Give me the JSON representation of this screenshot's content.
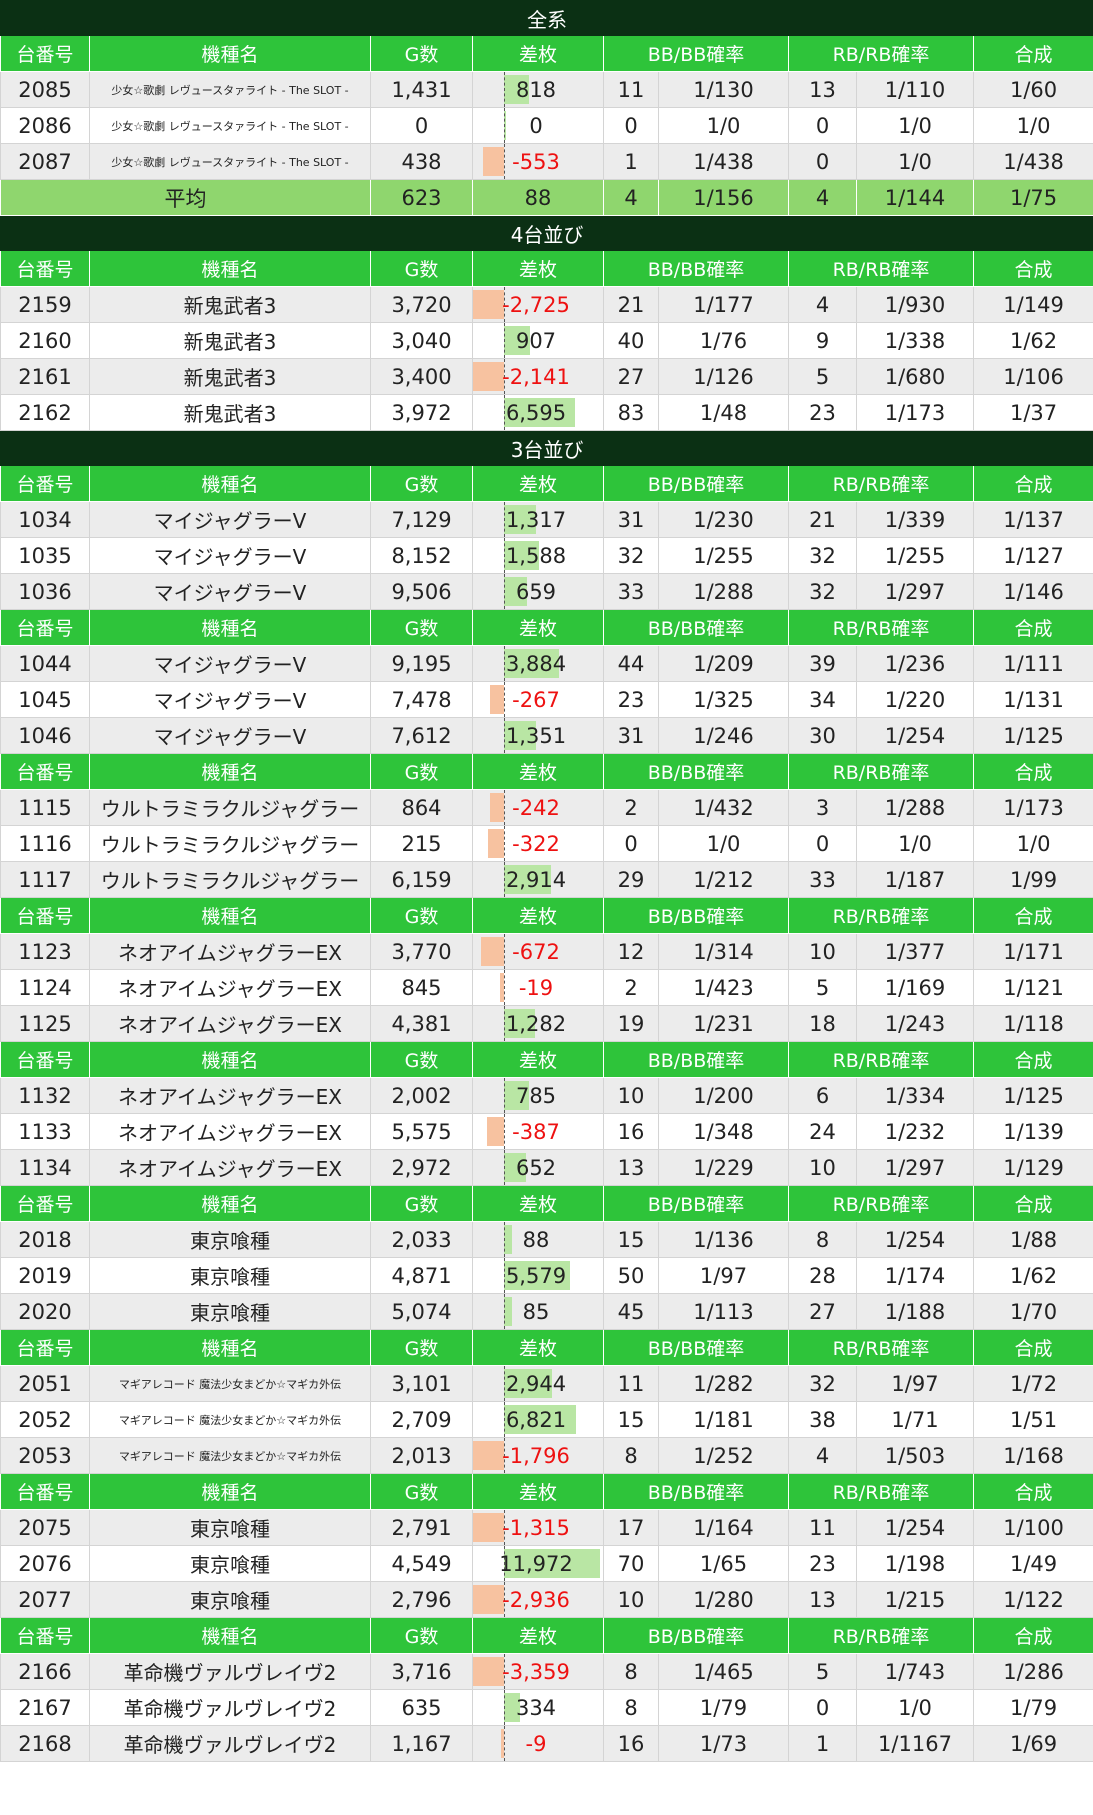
{
  "columns": [
    "台番号",
    "機種名",
    "G数",
    "差枚",
    "BB/BB確率",
    "RB/RB確率",
    "合成"
  ],
  "colors": {
    "section": "#0b3014",
    "header": "#2ec43a",
    "average": "#8fd66e",
    "positive_bar": "#b9e6a4",
    "negative_bar": "#f7c2a0",
    "negative_text": "#ee1111"
  },
  "sections": [
    {
      "title": "全系",
      "groups": [
        {
          "rows": [
            {
              "no": "2085",
              "name": "少女☆歌劇 レヴュースタァライト - The SLOT -",
              "g": "1,431",
              "diff": "818",
              "diff_value": 818,
              "bb": "11",
              "bbp": "1/130",
              "rb": "13",
              "rbp": "1/110",
              "total": "1/60"
            },
            {
              "no": "2086",
              "name": "少女☆歌劇 レヴュースタァライト - The SLOT -",
              "g": "0",
              "diff": "0",
              "diff_value": 0,
              "bb": "0",
              "bbp": "1/0",
              "rb": "0",
              "rbp": "1/0",
              "total": "1/0"
            },
            {
              "no": "2087",
              "name": "少女☆歌劇 レヴュースタァライト - The SLOT -",
              "g": "438",
              "diff": "-553",
              "diff_value": -553,
              "bb": "1",
              "bbp": "1/438",
              "rb": "0",
              "rbp": "1/0",
              "total": "1/438"
            }
          ]
        }
      ],
      "average": {
        "label": "平均",
        "g": "623",
        "diff": "88",
        "bb": "4",
        "bbp": "1/156",
        "rb": "4",
        "rbp": "1/144",
        "total": "1/75"
      }
    },
    {
      "title": "4台並び",
      "groups": [
        {
          "rows": [
            {
              "no": "2159",
              "name": "新鬼武者3",
              "g": "3,720",
              "diff": "-2,725",
              "diff_value": -2725,
              "bb": "21",
              "bbp": "1/177",
              "rb": "4",
              "rbp": "1/930",
              "total": "1/149"
            },
            {
              "no": "2160",
              "name": "新鬼武者3",
              "g": "3,040",
              "diff": "907",
              "diff_value": 907,
              "bb": "40",
              "bbp": "1/76",
              "rb": "9",
              "rbp": "1/338",
              "total": "1/62"
            },
            {
              "no": "2161",
              "name": "新鬼武者3",
              "g": "3,400",
              "diff": "-2,141",
              "diff_value": -2141,
              "bb": "27",
              "bbp": "1/126",
              "rb": "5",
              "rbp": "1/680",
              "total": "1/106"
            },
            {
              "no": "2162",
              "name": "新鬼武者3",
              "g": "3,972",
              "diff": "6,595",
              "diff_value": 6595,
              "bb": "83",
              "bbp": "1/48",
              "rb": "23",
              "rbp": "1/173",
              "total": "1/37"
            }
          ]
        }
      ]
    },
    {
      "title": "3台並び",
      "groups": [
        {
          "rows": [
            {
              "no": "1034",
              "name": "マイジャグラーV",
              "g": "7,129",
              "diff": "1,317",
              "diff_value": 1317,
              "bb": "31",
              "bbp": "1/230",
              "rb": "21",
              "rbp": "1/339",
              "total": "1/137"
            },
            {
              "no": "1035",
              "name": "マイジャグラーV",
              "g": "8,152",
              "diff": "1,588",
              "diff_value": 1588,
              "bb": "32",
              "bbp": "1/255",
              "rb": "32",
              "rbp": "1/255",
              "total": "1/127"
            },
            {
              "no": "1036",
              "name": "マイジャグラーV",
              "g": "9,506",
              "diff": "659",
              "diff_value": 659,
              "bb": "33",
              "bbp": "1/288",
              "rb": "32",
              "rbp": "1/297",
              "total": "1/146"
            }
          ]
        },
        {
          "rows": [
            {
              "no": "1044",
              "name": "マイジャグラーV",
              "g": "9,195",
              "diff": "3,884",
              "diff_value": 3884,
              "bb": "44",
              "bbp": "1/209",
              "rb": "39",
              "rbp": "1/236",
              "total": "1/111"
            },
            {
              "no": "1045",
              "name": "マイジャグラーV",
              "g": "7,478",
              "diff": "-267",
              "diff_value": -267,
              "bb": "23",
              "bbp": "1/325",
              "rb": "34",
              "rbp": "1/220",
              "total": "1/131"
            },
            {
              "no": "1046",
              "name": "マイジャグラーV",
              "g": "7,612",
              "diff": "1,351",
              "diff_value": 1351,
              "bb": "31",
              "bbp": "1/246",
              "rb": "30",
              "rbp": "1/254",
              "total": "1/125"
            }
          ]
        },
        {
          "rows": [
            {
              "no": "1115",
              "name": "ウルトラミラクルジャグラー",
              "g": "864",
              "diff": "-242",
              "diff_value": -242,
              "bb": "2",
              "bbp": "1/432",
              "rb": "3",
              "rbp": "1/288",
              "total": "1/173"
            },
            {
              "no": "1116",
              "name": "ウルトラミラクルジャグラー",
              "g": "215",
              "diff": "-322",
              "diff_value": -322,
              "bb": "0",
              "bbp": "1/0",
              "rb": "0",
              "rbp": "1/0",
              "total": "1/0"
            },
            {
              "no": "1117",
              "name": "ウルトラミラクルジャグラー",
              "g": "6,159",
              "diff": "2,914",
              "diff_value": 2914,
              "bb": "29",
              "bbp": "1/212",
              "rb": "33",
              "rbp": "1/187",
              "total": "1/99"
            }
          ]
        },
        {
          "rows": [
            {
              "no": "1123",
              "name": "ネオアイムジャグラーEX",
              "g": "3,770",
              "diff": "-672",
              "diff_value": -672,
              "bb": "12",
              "bbp": "1/314",
              "rb": "10",
              "rbp": "1/377",
              "total": "1/171"
            },
            {
              "no": "1124",
              "name": "ネオアイムジャグラーEX",
              "g": "845",
              "diff": "-19",
              "diff_value": -19,
              "bb": "2",
              "bbp": "1/423",
              "rb": "5",
              "rbp": "1/169",
              "total": "1/121"
            },
            {
              "no": "1125",
              "name": "ネオアイムジャグラーEX",
              "g": "4,381",
              "diff": "1,282",
              "diff_value": 1282,
              "bb": "19",
              "bbp": "1/231",
              "rb": "18",
              "rbp": "1/243",
              "total": "1/118"
            }
          ]
        },
        {
          "rows": [
            {
              "no": "1132",
              "name": "ネオアイムジャグラーEX",
              "g": "2,002",
              "diff": "785",
              "diff_value": 785,
              "bb": "10",
              "bbp": "1/200",
              "rb": "6",
              "rbp": "1/334",
              "total": "1/125"
            },
            {
              "no": "1133",
              "name": "ネオアイムジャグラーEX",
              "g": "5,575",
              "diff": "-387",
              "diff_value": -387,
              "bb": "16",
              "bbp": "1/348",
              "rb": "24",
              "rbp": "1/232",
              "total": "1/139"
            },
            {
              "no": "1134",
              "name": "ネオアイムジャグラーEX",
              "g": "2,972",
              "diff": "652",
              "diff_value": 652,
              "bb": "13",
              "bbp": "1/229",
              "rb": "10",
              "rbp": "1/297",
              "total": "1/129"
            }
          ]
        },
        {
          "rows": [
            {
              "no": "2018",
              "name": "東京喰種",
              "g": "2,033",
              "diff": "88",
              "diff_value": 88,
              "bb": "15",
              "bbp": "1/136",
              "rb": "8",
              "rbp": "1/254",
              "total": "1/88"
            },
            {
              "no": "2019",
              "name": "東京喰種",
              "g": "4,871",
              "diff": "5,579",
              "diff_value": 5579,
              "bb": "50",
              "bbp": "1/97",
              "rb": "28",
              "rbp": "1/174",
              "total": "1/62"
            },
            {
              "no": "2020",
              "name": "東京喰種",
              "g": "5,074",
              "diff": "85",
              "diff_value": 85,
              "bb": "45",
              "bbp": "1/113",
              "rb": "27",
              "rbp": "1/188",
              "total": "1/70"
            }
          ]
        },
        {
          "rows": [
            {
              "no": "2051",
              "name": "マギアレコード 魔法少女まどか☆マギカ外伝",
              "g": "3,101",
              "diff": "2,944",
              "diff_value": 2944,
              "bb": "11",
              "bbp": "1/282",
              "rb": "32",
              "rbp": "1/97",
              "total": "1/72"
            },
            {
              "no": "2052",
              "name": "マギアレコード 魔法少女まどか☆マギカ外伝",
              "g": "2,709",
              "diff": "6,821",
              "diff_value": 6821,
              "bb": "15",
              "bbp": "1/181",
              "rb": "38",
              "rbp": "1/71",
              "total": "1/51"
            },
            {
              "no": "2053",
              "name": "マギアレコード 魔法少女まどか☆マギカ外伝",
              "g": "2,013",
              "diff": "-1,796",
              "diff_value": -1796,
              "bb": "8",
              "bbp": "1/252",
              "rb": "4",
              "rbp": "1/503",
              "total": "1/168"
            }
          ]
        },
        {
          "rows": [
            {
              "no": "2075",
              "name": "東京喰種",
              "g": "2,791",
              "diff": "-1,315",
              "diff_value": -1315,
              "bb": "17",
              "bbp": "1/164",
              "rb": "11",
              "rbp": "1/254",
              "total": "1/100"
            },
            {
              "no": "2076",
              "name": "東京喰種",
              "g": "4,549",
              "diff": "11,972",
              "diff_value": 11972,
              "bb": "70",
              "bbp": "1/65",
              "rb": "23",
              "rbp": "1/198",
              "total": "1/49"
            },
            {
              "no": "2077",
              "name": "東京喰種",
              "g": "2,796",
              "diff": "-2,936",
              "diff_value": -2936,
              "bb": "10",
              "bbp": "1/280",
              "rb": "13",
              "rbp": "1/215",
              "total": "1/122"
            }
          ]
        },
        {
          "rows": [
            {
              "no": "2166",
              "name": "革命機ヴァルヴレイヴ2",
              "g": "3,716",
              "diff": "-3,359",
              "diff_value": -3359,
              "bb": "8",
              "bbp": "1/465",
              "rb": "5",
              "rbp": "1/743",
              "total": "1/286"
            },
            {
              "no": "2167",
              "name": "革命機ヴァルヴレイヴ2",
              "g": "635",
              "diff": "334",
              "diff_value": 334,
              "bb": "8",
              "bbp": "1/79",
              "rb": "0",
              "rbp": "1/0",
              "total": "1/79"
            },
            {
              "no": "2168",
              "name": "革命機ヴァルヴレイヴ2",
              "g": "1,167",
              "diff": "-9",
              "diff_value": -9,
              "bb": "16",
              "bbp": "1/73",
              "rb": "1",
              "rbp": "1/1167",
              "total": "1/69"
            }
          ]
        }
      ]
    }
  ]
}
